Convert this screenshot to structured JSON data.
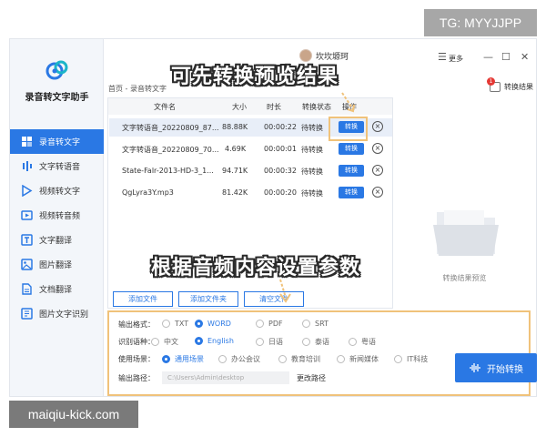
{
  "watermarks": {
    "tg": "TG: MYYJJPP",
    "site": "maiqiu-kick.com"
  },
  "app": {
    "name": "录音转文字助手",
    "user": "坎坎塬珂",
    "more": "更多"
  },
  "nav": [
    {
      "label": "录音转文字",
      "icon": "record-icon",
      "active": true
    },
    {
      "label": "文字转语音",
      "icon": "voice-icon"
    },
    {
      "label": "视频转文字",
      "icon": "video-icon"
    },
    {
      "label": "视频转音频",
      "icon": "video-audio-icon"
    },
    {
      "label": "文字翻译",
      "icon": "translate-icon"
    },
    {
      "label": "图片翻译",
      "icon": "image-translate-icon"
    },
    {
      "label": "文档翻译",
      "icon": "document-icon"
    },
    {
      "label": "图片文字识别",
      "icon": "ocr-icon"
    }
  ],
  "breadcrumb": "首页 - 录音转文字",
  "preview_button": {
    "label": "转换结果",
    "count": "1"
  },
  "table": {
    "headers": [
      "文件名",
      "大小",
      "时长",
      "转换状态",
      "操作"
    ],
    "rows": [
      {
        "name": "文字转语音_20220809_87...",
        "size": "88.88K",
        "duration": "00:00:22",
        "status": "待转换",
        "action": "转换"
      },
      {
        "name": "文字转语音_20220809_70...",
        "size": "4.69K",
        "duration": "00:00:01",
        "status": "待转换",
        "action": "转换"
      },
      {
        "name": "State-Falr-2013-HD-3_1...",
        "size": "94.71K",
        "duration": "00:00:32",
        "status": "待转换",
        "action": "转换"
      },
      {
        "name": "QgLyra3Y.mp3",
        "size": "81.42K",
        "duration": "00:00:20",
        "status": "待转换",
        "action": "转换"
      }
    ]
  },
  "preview_label": "转换结果预览",
  "buttons": {
    "add_file": "添加文件",
    "add_folder": "添加文件夹",
    "clear": "清空文件",
    "start": "开始转换",
    "change_path": "更改路径"
  },
  "settings": {
    "format_label": "输出格式：",
    "formats": [
      "TXT",
      "WORD",
      "PDF",
      "SRT"
    ],
    "selected_format": "WORD",
    "language_label": "识别语种：",
    "languages": [
      "中文",
      "English",
      "日语",
      "泰语",
      "粤语"
    ],
    "selected_language": "English",
    "scene_label": "使用场景：",
    "scenes": [
      "通用场景",
      "办公会议",
      "教育培训",
      "新闻媒体",
      "IT科技"
    ],
    "selected_scene": "通用场景",
    "path_label": "输出路径：",
    "path": "C:\\Users\\Admin\\desktop"
  },
  "annotations": {
    "top": "可先转换预览结果",
    "middle": "根据音频内容设置参数"
  },
  "colors": {
    "accent": "#2a78e4",
    "highlight": "#f0c27a"
  }
}
